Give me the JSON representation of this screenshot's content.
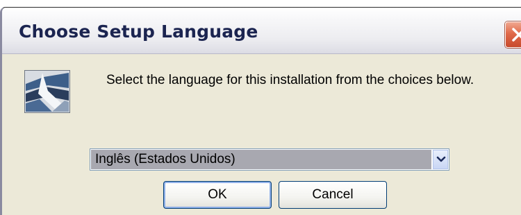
{
  "window": {
    "title": "Choose Setup Language",
    "close_icon": "close-icon",
    "app_icon": "setup-wizard-icon"
  },
  "content": {
    "message": "Select the language for this installation from the choices below."
  },
  "language_select": {
    "selected": "Inglês (Estados Unidos)",
    "arrow_icon": "chevron-down-icon"
  },
  "buttons": {
    "ok": "OK",
    "cancel": "Cancel"
  },
  "colors": {
    "dialog_background": "#ece9d8",
    "title_text": "#1b2450",
    "close_button": "#e06a4a",
    "selected_item_background": "#a8a8b0",
    "button_border": "#003c74"
  }
}
